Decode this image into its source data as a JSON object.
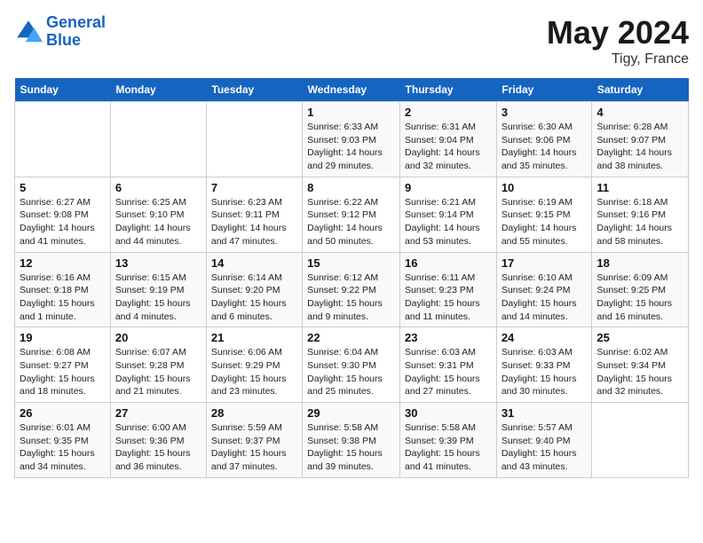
{
  "logo": {
    "line1": "General",
    "line2": "Blue"
  },
  "title": "May 2024",
  "subtitle": "Tigy, France",
  "days_of_week": [
    "Sunday",
    "Monday",
    "Tuesday",
    "Wednesday",
    "Thursday",
    "Friday",
    "Saturday"
  ],
  "weeks": [
    [
      {
        "day": "",
        "info": ""
      },
      {
        "day": "",
        "info": ""
      },
      {
        "day": "",
        "info": ""
      },
      {
        "day": "1",
        "info": "Sunrise: 6:33 AM\nSunset: 9:03 PM\nDaylight: 14 hours\nand 29 minutes."
      },
      {
        "day": "2",
        "info": "Sunrise: 6:31 AM\nSunset: 9:04 PM\nDaylight: 14 hours\nand 32 minutes."
      },
      {
        "day": "3",
        "info": "Sunrise: 6:30 AM\nSunset: 9:06 PM\nDaylight: 14 hours\nand 35 minutes."
      },
      {
        "day": "4",
        "info": "Sunrise: 6:28 AM\nSunset: 9:07 PM\nDaylight: 14 hours\nand 38 minutes."
      }
    ],
    [
      {
        "day": "5",
        "info": "Sunrise: 6:27 AM\nSunset: 9:08 PM\nDaylight: 14 hours\nand 41 minutes."
      },
      {
        "day": "6",
        "info": "Sunrise: 6:25 AM\nSunset: 9:10 PM\nDaylight: 14 hours\nand 44 minutes."
      },
      {
        "day": "7",
        "info": "Sunrise: 6:23 AM\nSunset: 9:11 PM\nDaylight: 14 hours\nand 47 minutes."
      },
      {
        "day": "8",
        "info": "Sunrise: 6:22 AM\nSunset: 9:12 PM\nDaylight: 14 hours\nand 50 minutes."
      },
      {
        "day": "9",
        "info": "Sunrise: 6:21 AM\nSunset: 9:14 PM\nDaylight: 14 hours\nand 53 minutes."
      },
      {
        "day": "10",
        "info": "Sunrise: 6:19 AM\nSunset: 9:15 PM\nDaylight: 14 hours\nand 55 minutes."
      },
      {
        "day": "11",
        "info": "Sunrise: 6:18 AM\nSunset: 9:16 PM\nDaylight: 14 hours\nand 58 minutes."
      }
    ],
    [
      {
        "day": "12",
        "info": "Sunrise: 6:16 AM\nSunset: 9:18 PM\nDaylight: 15 hours\nand 1 minute."
      },
      {
        "day": "13",
        "info": "Sunrise: 6:15 AM\nSunset: 9:19 PM\nDaylight: 15 hours\nand 4 minutes."
      },
      {
        "day": "14",
        "info": "Sunrise: 6:14 AM\nSunset: 9:20 PM\nDaylight: 15 hours\nand 6 minutes."
      },
      {
        "day": "15",
        "info": "Sunrise: 6:12 AM\nSunset: 9:22 PM\nDaylight: 15 hours\nand 9 minutes."
      },
      {
        "day": "16",
        "info": "Sunrise: 6:11 AM\nSunset: 9:23 PM\nDaylight: 15 hours\nand 11 minutes."
      },
      {
        "day": "17",
        "info": "Sunrise: 6:10 AM\nSunset: 9:24 PM\nDaylight: 15 hours\nand 14 minutes."
      },
      {
        "day": "18",
        "info": "Sunrise: 6:09 AM\nSunset: 9:25 PM\nDaylight: 15 hours\nand 16 minutes."
      }
    ],
    [
      {
        "day": "19",
        "info": "Sunrise: 6:08 AM\nSunset: 9:27 PM\nDaylight: 15 hours\nand 18 minutes."
      },
      {
        "day": "20",
        "info": "Sunrise: 6:07 AM\nSunset: 9:28 PM\nDaylight: 15 hours\nand 21 minutes."
      },
      {
        "day": "21",
        "info": "Sunrise: 6:06 AM\nSunset: 9:29 PM\nDaylight: 15 hours\nand 23 minutes."
      },
      {
        "day": "22",
        "info": "Sunrise: 6:04 AM\nSunset: 9:30 PM\nDaylight: 15 hours\nand 25 minutes."
      },
      {
        "day": "23",
        "info": "Sunrise: 6:03 AM\nSunset: 9:31 PM\nDaylight: 15 hours\nand 27 minutes."
      },
      {
        "day": "24",
        "info": "Sunrise: 6:03 AM\nSunset: 9:33 PM\nDaylight: 15 hours\nand 30 minutes."
      },
      {
        "day": "25",
        "info": "Sunrise: 6:02 AM\nSunset: 9:34 PM\nDaylight: 15 hours\nand 32 minutes."
      }
    ],
    [
      {
        "day": "26",
        "info": "Sunrise: 6:01 AM\nSunset: 9:35 PM\nDaylight: 15 hours\nand 34 minutes."
      },
      {
        "day": "27",
        "info": "Sunrise: 6:00 AM\nSunset: 9:36 PM\nDaylight: 15 hours\nand 36 minutes."
      },
      {
        "day": "28",
        "info": "Sunrise: 5:59 AM\nSunset: 9:37 PM\nDaylight: 15 hours\nand 37 minutes."
      },
      {
        "day": "29",
        "info": "Sunrise: 5:58 AM\nSunset: 9:38 PM\nDaylight: 15 hours\nand 39 minutes."
      },
      {
        "day": "30",
        "info": "Sunrise: 5:58 AM\nSunset: 9:39 PM\nDaylight: 15 hours\nand 41 minutes."
      },
      {
        "day": "31",
        "info": "Sunrise: 5:57 AM\nSunset: 9:40 PM\nDaylight: 15 hours\nand 43 minutes."
      },
      {
        "day": "",
        "info": ""
      }
    ]
  ]
}
